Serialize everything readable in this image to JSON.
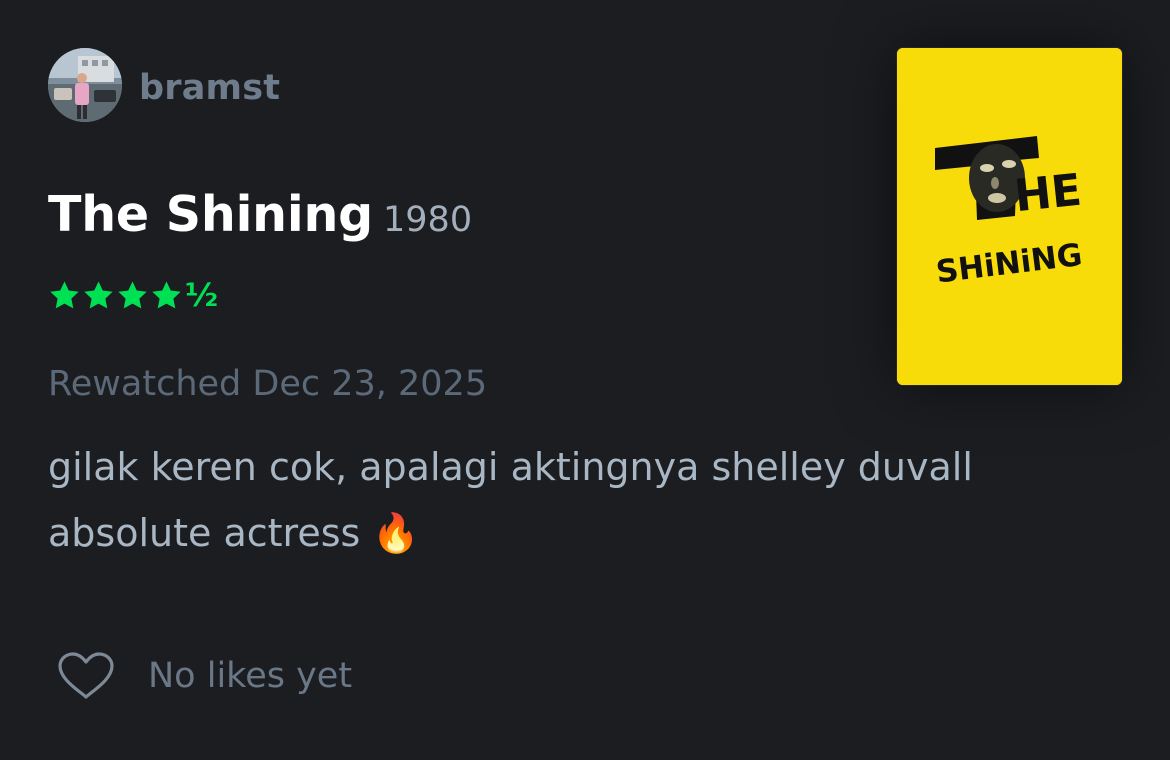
{
  "user": {
    "username": "bramst",
    "avatar_icon": "user-avatar-photo"
  },
  "film": {
    "title": "The Shining",
    "year": "1980",
    "poster_title_top": "HE",
    "poster_title_bottom": "SHiNiNG"
  },
  "rating": {
    "stars": 4.5,
    "max": 5,
    "half_glyph": "½",
    "color": "#00e054"
  },
  "entry": {
    "watch_status": "Rewatched Dec 23, 2025",
    "review_text": "gilak keren cok, apalagi aktingnya shelley duvall absolute actress 🔥"
  },
  "likes": {
    "label": "No likes yet",
    "icon": "heart-outline-icon"
  },
  "colors": {
    "background": "#1b1d21",
    "poster_yellow": "#f8dc0a"
  }
}
